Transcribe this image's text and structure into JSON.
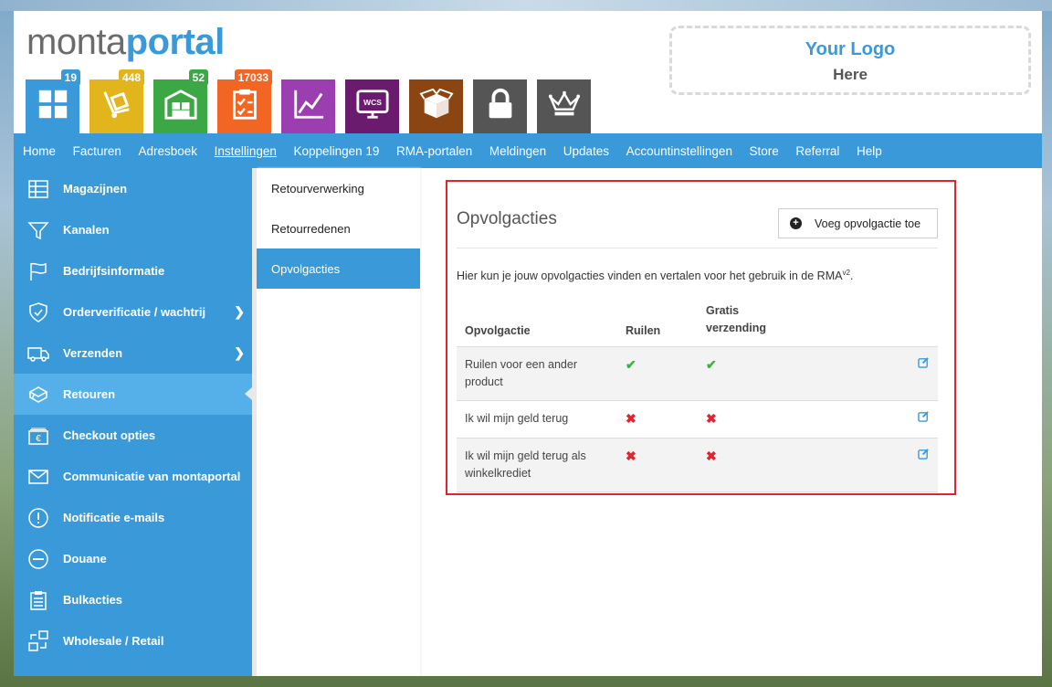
{
  "brand": {
    "part1": "monta",
    "part2": "portal"
  },
  "logo_placeholder": {
    "line1": "Your Logo",
    "line2": "Here"
  },
  "tiles": [
    {
      "name": "dashboard",
      "color": "#3a9ad9",
      "badge": "19",
      "badge_color": "#3a9ad9"
    },
    {
      "name": "shipping",
      "color": "#e3b51d",
      "badge": "448",
      "badge_color": "#e3b51d"
    },
    {
      "name": "warehouse",
      "color": "#3ba845",
      "badge": "52",
      "badge_color": "#3ba845"
    },
    {
      "name": "orders",
      "color": "#f26522",
      "badge": "17033",
      "badge_color": "#f26522"
    },
    {
      "name": "statistics",
      "color": "#9b3fb0",
      "badge": "",
      "badge_color": ""
    },
    {
      "name": "wcs",
      "color": "#6a1b6e",
      "badge": "",
      "badge_color": "",
      "label": "WCS"
    },
    {
      "name": "packages",
      "color": "#8b4513",
      "badge": "",
      "badge_color": ""
    },
    {
      "name": "lock",
      "color": "#555555",
      "badge": "",
      "badge_color": ""
    },
    {
      "name": "crown",
      "color": "#555555",
      "badge": "",
      "badge_color": ""
    }
  ],
  "topnav": [
    "Home",
    "Facturen",
    "Adresboek",
    "Instellingen",
    "Koppelingen 19",
    "RMA-portalen",
    "Meldingen",
    "Updates",
    "Accountinstellingen",
    "Store",
    "Referral",
    "Help"
  ],
  "sidebar": [
    "Magazijnen",
    "Kanalen",
    "Bedrijfsinformatie",
    "Orderverificatie / wachtrij",
    "Verzenden",
    "Retouren",
    "Checkout opties",
    "Communicatie van montaportal",
    "Notificatie e-mails",
    "Douane",
    "Bulkacties",
    "Wholesale / Retail"
  ],
  "subnav": [
    "Retourverwerking",
    "Retourredenen",
    "Opvolgacties"
  ],
  "main": {
    "title": "Opvolgacties",
    "add_button": "Voeg opvolgactie toe",
    "intro": "Hier kun je jouw opvolgacties vinden en vertalen voor het gebruik in de RMA",
    "intro_sup": "v2",
    "columns": [
      "Opvolgactie",
      "Ruilen",
      "Gratis verzending"
    ],
    "rows": [
      {
        "name": "Ruilen voor een ander product",
        "ruilen": true,
        "gratis": true
      },
      {
        "name": "Ik wil mijn geld terug",
        "ruilen": false,
        "gratis": false
      },
      {
        "name": "Ik wil mijn geld terug als winkelkrediet",
        "ruilen": false,
        "gratis": false
      }
    ]
  },
  "colors": {
    "accent": "#3a9ad9",
    "highlight_border": "#e0232f",
    "check": "#3cb043",
    "cross": "#e0232f"
  }
}
